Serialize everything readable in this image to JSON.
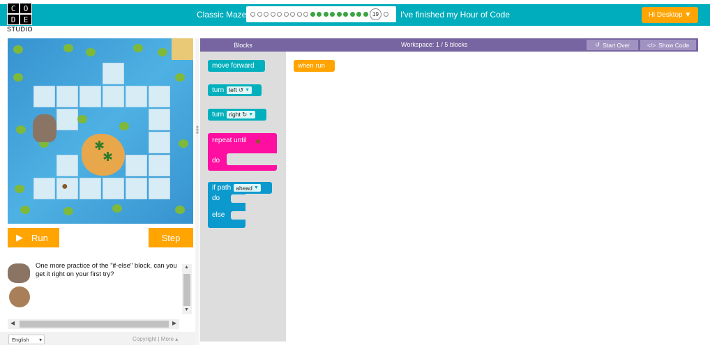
{
  "header": {
    "logo_letters": [
      "C",
      "O",
      "D",
      "E"
    ],
    "logo_studio": "STUDIO",
    "maze_title": "Classic Maze",
    "current_level": "19",
    "finished_link": "I've finished my Hour of Code",
    "user_button": "Hi Desktop ▼",
    "brand_color": "#00adbc"
  },
  "controls": {
    "run_label": "Run",
    "step_label": "Step"
  },
  "instructions": {
    "text": "One more practice of the \"if-else\" block, can you get it right on your first try?"
  },
  "footer": {
    "language": "English",
    "copyright": "Copyright",
    "separator": "|",
    "more": "More ▴"
  },
  "blocks_panel": {
    "title": "Blocks",
    "move_forward": "move forward",
    "turn1_label": "turn",
    "turn1_dir": "left ↺",
    "turn2_label": "turn",
    "turn2_dir": "right ↻",
    "repeat_label": "repeat until",
    "repeat_do": "do",
    "if_label": "if path",
    "if_dir": "ahead",
    "if_do": "do",
    "if_else": "else"
  },
  "workspace": {
    "title": "Workspace: 1 / 5 blocks",
    "start_over": "Start Over",
    "show_code": "Show Code",
    "when_run": "when run"
  }
}
